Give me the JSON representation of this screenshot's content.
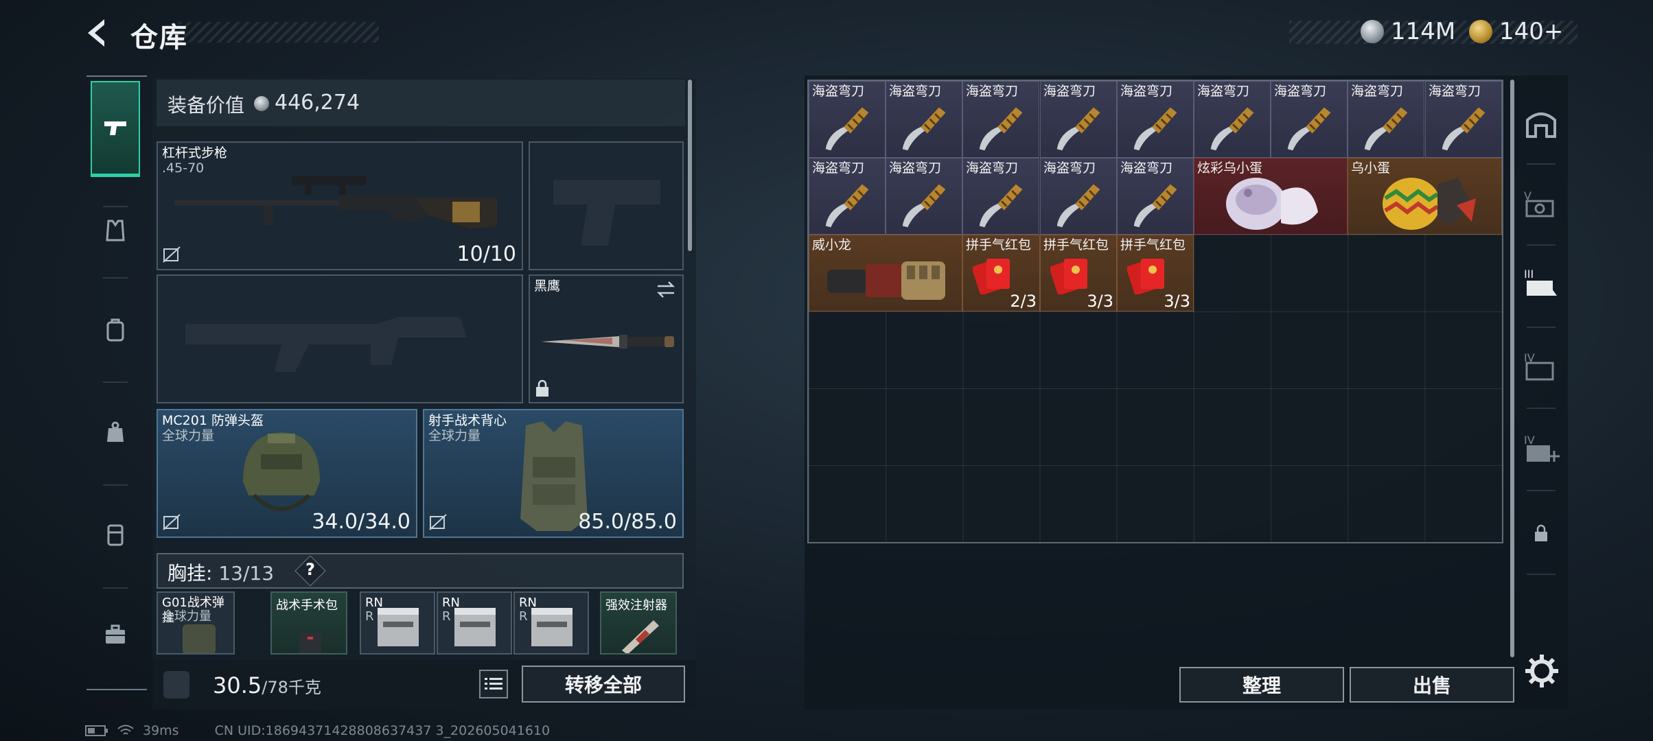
{
  "header": {
    "title": "仓库",
    "currency1": "114M",
    "currency2": "140+"
  },
  "equipment": {
    "value_label": "装备价值",
    "value": "446,274",
    "rifle": {
      "name": "杠杆式步枪",
      "caliber": ".45-70",
      "ammo": "10/10"
    },
    "knife": {
      "name": "黑鹰"
    },
    "helmet": {
      "name": "MC201 防弹头盔",
      "tag": "全球力量",
      "durability": "34.0/34.0"
    },
    "vest": {
      "name": "射手战术背心",
      "tag": "全球力量",
      "durability": "85.0/85.0"
    },
    "chest": {
      "label": "胸挂:",
      "count": "13/13",
      "help": "?"
    },
    "rig_items": [
      {
        "name": "G01战术弹挂",
        "tag": "全球力量"
      },
      {
        "name": "战术手术包",
        "tag": ""
      },
      {
        "name": "RN",
        "tag": "R"
      },
      {
        "name": "RN",
        "tag": "R"
      },
      {
        "name": "RN",
        "tag": "R"
      },
      {
        "name": "强效注射器",
        "tag": ""
      }
    ]
  },
  "weight": {
    "value": "30.5",
    "max": "/78千克"
  },
  "buttons": {
    "transfer_all": "转移全部",
    "sort": "整理",
    "sell": "出售"
  },
  "status": {
    "ping": "39ms",
    "uid": "CN UID:18694371428808637437 3_202605041610"
  },
  "stash": {
    "knife_name": "海盗弯刀",
    "rows": [
      [
        {
          "name": "海盗弯刀"
        },
        {
          "name": "海盗弯刀"
        },
        {
          "name": "海盗弯刀"
        },
        {
          "name": "海盗弯刀"
        },
        {
          "name": "海盗弯刀"
        },
        {
          "name": "海盗弯刀"
        },
        {
          "name": "海盗弯刀"
        },
        {
          "name": "海盗弯刀"
        },
        {
          "name": "海盗弯刀"
        }
      ],
      [
        {
          "name": "海盗弯刀"
        },
        {
          "name": "海盗弯刀"
        },
        {
          "name": "海盗弯刀"
        },
        {
          "name": "海盗弯刀"
        },
        {
          "name": "海盗弯刀"
        }
      ]
    ],
    "egg1": {
      "name": "炫彩乌小蛋"
    },
    "egg2": {
      "name": "乌小蛋"
    },
    "dragon": {
      "name": "威小龙"
    },
    "redpacks": [
      {
        "name": "拼手气红包",
        "count": "2/3"
      },
      {
        "name": "拼手气红包",
        "count": "3/3"
      },
      {
        "name": "拼手气红包",
        "count": "3/3"
      }
    ]
  },
  "colors": {
    "accent": "#2bd1a4",
    "purple_rarity": "#3a3c54",
    "red_rarity": "#5a2326",
    "orange_rarity": "#5a3b22"
  }
}
